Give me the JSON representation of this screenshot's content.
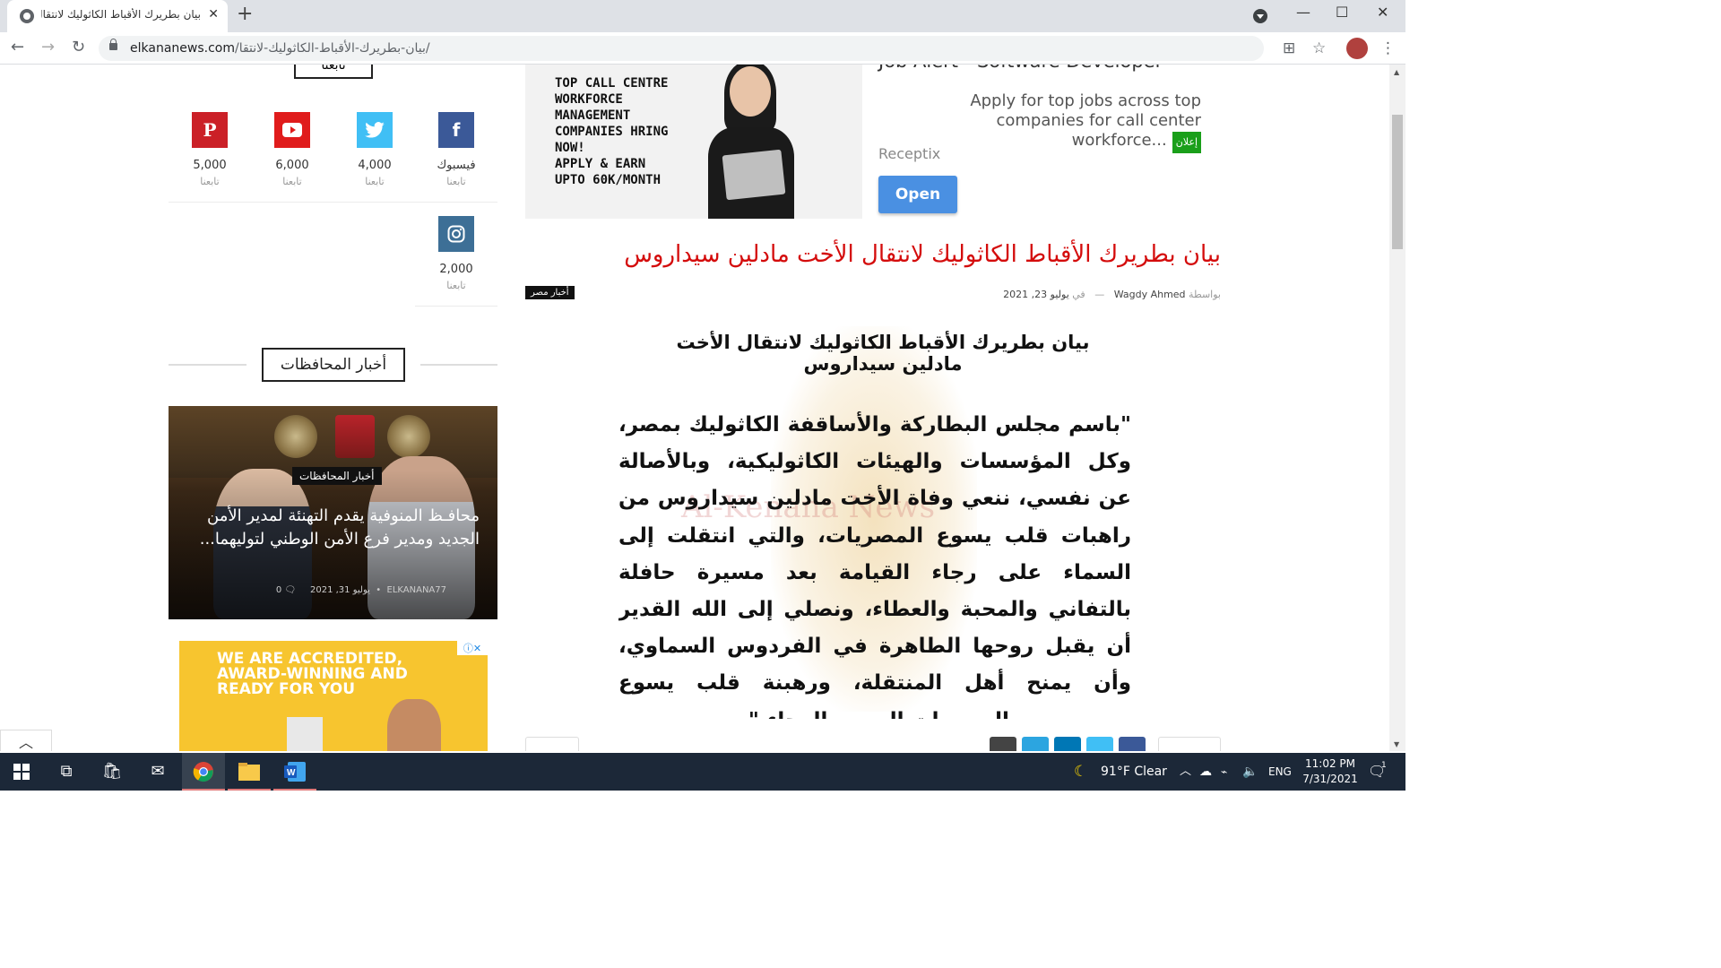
{
  "browser": {
    "tab_title": "بيان بطريرك الأقباط الكاثوليك لانتقال",
    "url_host": "elkananews.com",
    "url_path": "/بيان-بطريرك-الأقباط-الكاثوليك-لانتقا/"
  },
  "sidebar": {
    "follow_heading": "تابعنا",
    "social": [
      {
        "name": "فيسبوك",
        "count": "",
        "label": "تابعنا",
        "color": "#3b5998",
        "icon": "f"
      },
      {
        "name": "twitter",
        "count": "4,000",
        "label": "تابعنا",
        "color": "#40bff5",
        "icon": "twitter-bird"
      },
      {
        "name": "youtube",
        "count": "6,000",
        "label": "تابعنا",
        "color": "#e01c1c",
        "icon": "play"
      },
      {
        "name": "pinterest",
        "count": "5,000",
        "label": "تابعنا",
        "color": "#cb2027",
        "icon": "P"
      },
      {
        "name": "instagram",
        "count": "2,000",
        "label": "تابعنا",
        "color": "#3d6f96",
        "icon": "camera"
      }
    ],
    "section_title": "أخبار المحافظات",
    "feature": {
      "category": "أخبار المحافظات",
      "title": "محافـظ المنوفية يقدم التهنئة لمدير الأمن الجديد ومدير فرع الأمن الوطني لتوليهما...",
      "author": "ELKANANA77",
      "date": "يوليو 31, 2021",
      "comments": "0"
    },
    "ad2_text": [
      "WE ARE ACCREDITED,",
      "AWARD-WINNING AND",
      "READY FOR YOU"
    ]
  },
  "main": {
    "ad": {
      "banner_lines": [
        "TOP CALL CENTRE",
        "WORKFORCE",
        "MANAGEMENT",
        "COMPANIES HRING",
        "NOW!",
        "APPLY & EARN",
        "UPTO 60K/MONTH"
      ],
      "job_title": "Job Alert - Software Developer",
      "desc": "Apply for top jobs across top companies for call center workforce...",
      "badge": "إعلان",
      "brand": "Receptix",
      "open": "Open"
    },
    "article": {
      "title": "بيان بطريرك الأقباط الكاثوليك لانتقال الأخت مادلين سيداروس",
      "category": "أخبار مصر",
      "by": "بواسطة",
      "author": "Wagdy Ahmed",
      "in": "في",
      "date": "يوليو 23, 2021",
      "image_heading": "بيان بطريرك الأقباط الكاثوليك لانتقال الأخت مادلين سيداروس",
      "image_body": "\"باسم مجلس البطاركة والأساقفة الكاثوليك بمصر، وكل المؤسسات والهيئات الكاثوليكية، وبالأصالة عن نفسي، ننعي وفاة الأخت مادلين سيداروس من راهبات قلب يسوع المصريات، والتي انتقلت إلى السماء على رجاء القيامة بعد مسيرة حافلة بالتفاني والمحبة والعطاء، ونصلي إلى الله القدير أن يقبل روحها الطاهرة في الفردوس السماوي، وأن يمنح أهل المنتقلة، ورهبنة قلب يسوع المصريات الصبر والرجاء.\".",
      "watermark": "Al-Kenana News"
    }
  },
  "taskbar": {
    "weather": "91°F  Clear",
    "lang": "ENG",
    "time": "11:02 PM",
    "date": "7/31/2021",
    "notif_count": "1"
  }
}
